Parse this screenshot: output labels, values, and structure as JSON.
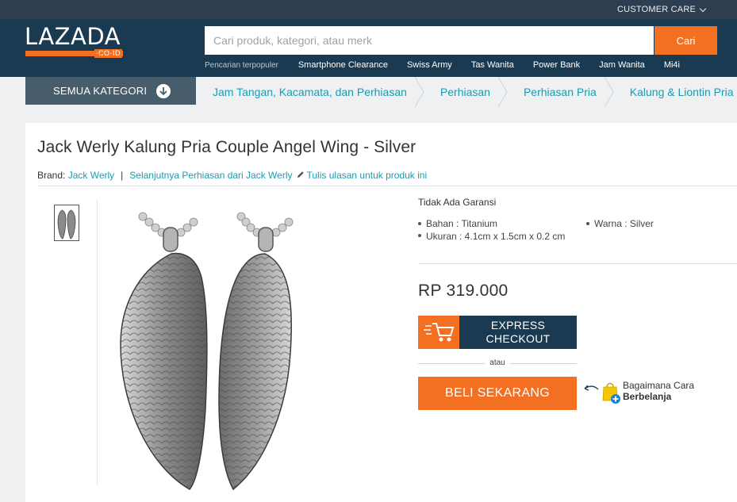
{
  "topbar": {
    "customer_care": "CUSTOMER CARE"
  },
  "header": {
    "logo_text": "LAZADA",
    "logo_domain": "·CO·ID",
    "search_placeholder": "Cari produk, kategori, atau merk",
    "search_button": "Cari",
    "popular_label": "Pencarian terpopuler",
    "popular_links": [
      "Smartphone Clearance",
      "Swiss Army",
      "Tas Wanita",
      "Power Bank",
      "Jam Wanita",
      "Mi4i"
    ]
  },
  "nav": {
    "all_categories": "SEMUA KATEGORI",
    "breadcrumbs": [
      "Jam Tangan, Kacamata, dan Perhiasan",
      "Perhiasan",
      "Perhiasan Pria",
      "Kalung & Liontin Pria"
    ]
  },
  "product": {
    "title": "Jack Werly Kalung Pria Couple Angel Wing - Silver",
    "brand_label": "Brand:",
    "brand_name": "Jack Werly",
    "more_from": "Selanjutnya Perhiasan dari Jack Werly",
    "write_review": "Tulis ulasan untuk produk ini",
    "warranty": "Tidak Ada Garansi",
    "specs": {
      "material": "Bahan : Titanium",
      "size": "Ukuran : 4.1cm x 1.5cm x 0.2 cm",
      "color": "Warna : Silver"
    },
    "price": "RP 319.000",
    "express_line1": "EXPRESS",
    "express_line2": "CHECKOUT",
    "or": "atau",
    "buy_now": "BELI SEKARANG",
    "howto_line1": "Bagaimana Cara",
    "howto_line2": "Berbelanja"
  },
  "colors": {
    "brand_orange": "#f36f21",
    "header_navy": "#1a3a52",
    "link_teal": "#1a9cb0"
  }
}
